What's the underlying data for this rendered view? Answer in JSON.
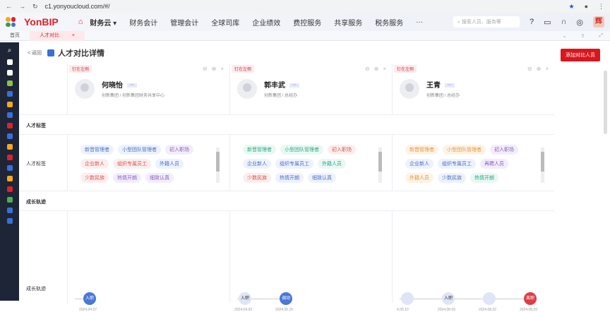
{
  "browser": {
    "url": "c1.yonyoucloud.com/#/"
  },
  "topnav": {
    "brand": "YonBIP",
    "current": "财务云 ▾",
    "items": [
      "财务会计",
      "管理会计",
      "全球司库",
      "企业绩效",
      "费控服务",
      "共享服务",
      "税务服务",
      "···"
    ],
    "search_placeholder": "搜索人员、服务等",
    "user_initial": "辉"
  },
  "tabs": [
    {
      "label": "首页"
    },
    {
      "label": "人才对比",
      "close": "×"
    }
  ],
  "page": {
    "back": "< 返回",
    "title": "人才对比详情",
    "add_button": "添加对比人员"
  },
  "pin_label": "钉在左侧",
  "sections": {
    "talent_tags": "人才标签",
    "growth": "成长轨迹"
  },
  "row_labels": {
    "tags": "人才标签",
    "growth": "成长轨迹"
  },
  "colors": {
    "blue": "#3a6fd8",
    "red": "#d9161e"
  },
  "people": [
    {
      "name": "何晓怡",
      "more": "···",
      "org": "创新集团 / 创新集团财务共享中心",
      "tags": [
        {
          "t": "新晋管理者",
          "c": "blue"
        },
        {
          "t": "小型团队管理者",
          "c": "blue"
        },
        {
          "t": "初入职场",
          "c": "purple"
        },
        {
          "t": "企业新人",
          "c": "red"
        },
        {
          "t": "组织专属员工",
          "c": "red"
        },
        {
          "t": "外籍人员",
          "c": "blue"
        },
        {
          "t": "少数民族",
          "c": "red"
        },
        {
          "t": "热情开朗",
          "c": "purple"
        },
        {
          "t": "细致认真",
          "c": "purple"
        }
      ],
      "timeline": [
        {
          "label": "入职",
          "date": "2024.04.07",
          "style": "blue"
        }
      ]
    },
    {
      "name": "郭丰武",
      "more": "···",
      "org": "创新集团 / 总经办",
      "tags": [
        {
          "t": "新晋管理者",
          "c": "green"
        },
        {
          "t": "小型团队管理者",
          "c": "green"
        },
        {
          "t": "初入职场",
          "c": "red"
        },
        {
          "t": "企业新人",
          "c": "blue"
        },
        {
          "t": "组织专属员工",
          "c": "blue"
        },
        {
          "t": "外籍人员",
          "c": "green"
        },
        {
          "t": "少数民族",
          "c": "red"
        },
        {
          "t": "热情开朗",
          "c": "blue"
        },
        {
          "t": "细致认真",
          "c": "blue"
        }
      ],
      "timeline": [
        {
          "label": "入职",
          "date": "2024.04.03",
          "style": "light"
        },
        {
          "label": "调动",
          "date": "2024.05.15",
          "style": "blue"
        }
      ]
    },
    {
      "name": "王青",
      "more": "···",
      "org": "创新集团 / 总经办",
      "tags": [
        {
          "t": "新晋管理者",
          "c": "orange"
        },
        {
          "t": "小型团队管理者",
          "c": "orange"
        },
        {
          "t": "初入职场",
          "c": "purple"
        },
        {
          "t": "企业新人",
          "c": "blue"
        },
        {
          "t": "组织专属员工",
          "c": "blue"
        },
        {
          "t": "再聘人员",
          "c": "purple"
        },
        {
          "t": "外籍人员",
          "c": "orange"
        },
        {
          "t": "少数民族",
          "c": "blue"
        },
        {
          "t": "热情开朗",
          "c": "green"
        }
      ],
      "timeline": [
        {
          "label": "",
          "date": "4.05.10",
          "style": "light"
        },
        {
          "label": "入职",
          "date": "2024.08.03",
          "style": "light"
        },
        {
          "label": "",
          "date": "2024.08.02",
          "style": "light"
        },
        {
          "label": "离职",
          "date": "2024.08.03",
          "style": "red"
        }
      ]
    }
  ]
}
